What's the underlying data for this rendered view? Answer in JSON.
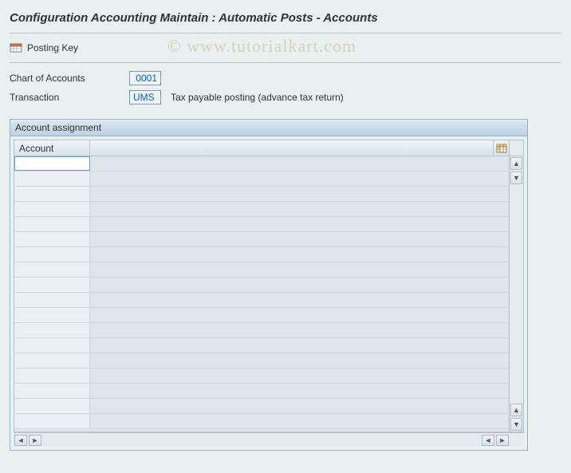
{
  "header": {
    "title": "Configuration Accounting Maintain : Automatic Posts - Accounts"
  },
  "toolbar": {
    "posting_key_label": "Posting Key"
  },
  "form": {
    "chart_of_accounts_label": "Chart of Accounts",
    "chart_of_accounts_value": "0001",
    "transaction_label": "Transaction",
    "transaction_value": "UMS",
    "transaction_desc": "Tax payable posting (advance tax return)"
  },
  "panel": {
    "title": "Account assignment",
    "column_account": "Account",
    "rows": [
      {
        "account": "",
        "editable": true
      },
      {
        "account": "",
        "editable": false
      },
      {
        "account": "",
        "editable": false
      },
      {
        "account": "",
        "editable": false
      },
      {
        "account": "",
        "editable": false
      },
      {
        "account": "",
        "editable": false
      },
      {
        "account": "",
        "editable": false
      },
      {
        "account": "",
        "editable": false
      },
      {
        "account": "",
        "editable": false
      },
      {
        "account": "",
        "editable": false
      },
      {
        "account": "",
        "editable": false
      },
      {
        "account": "",
        "editable": false
      },
      {
        "account": "",
        "editable": false
      },
      {
        "account": "",
        "editable": false
      },
      {
        "account": "",
        "editable": false
      },
      {
        "account": "",
        "editable": false
      },
      {
        "account": "",
        "editable": false
      },
      {
        "account": "",
        "editable": false
      }
    ]
  },
  "watermark": "© www.tutorialkart.com",
  "colors": {
    "background": "#e8f0f0",
    "link_blue": "#0066cc",
    "panel_border": "#9bb3c7"
  }
}
